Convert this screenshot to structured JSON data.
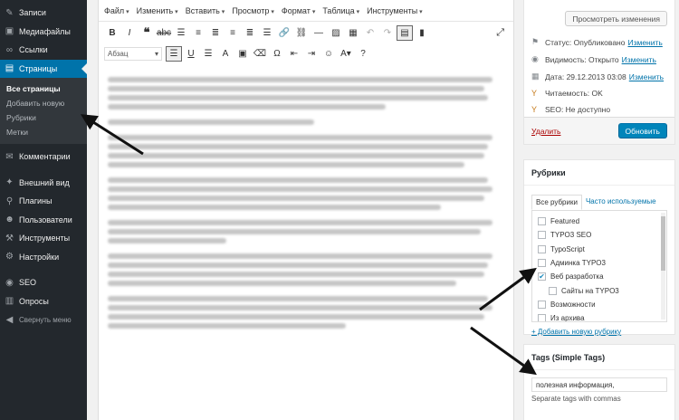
{
  "sidebar": {
    "items_top": [
      {
        "label": "Записи",
        "icon": "pin-icon",
        "glyph": "✎"
      },
      {
        "label": "Медиафайлы",
        "icon": "media-icon",
        "glyph": "▣"
      },
      {
        "label": "Ссылки",
        "icon": "link-icon",
        "glyph": "∞"
      }
    ],
    "active": {
      "label": "Страницы",
      "icon": "pages-icon",
      "glyph": "▤"
    },
    "sub_items": [
      "Все страницы",
      "Добавить новую",
      "Рубрики",
      "Метки"
    ],
    "items_mid": [
      {
        "label": "Комментарии",
        "icon": "comments-icon",
        "glyph": "✉"
      }
    ],
    "items_bottom": [
      {
        "label": "Внешний вид",
        "icon": "appearance-icon",
        "glyph": "✦"
      },
      {
        "label": "Плагины",
        "icon": "plugins-icon",
        "glyph": "⚲"
      },
      {
        "label": "Пользователи",
        "icon": "users-icon",
        "glyph": "☻"
      },
      {
        "label": "Инструменты",
        "icon": "tools-icon",
        "glyph": "⚒"
      },
      {
        "label": "Настройки",
        "icon": "settings-icon",
        "glyph": "⚙"
      }
    ],
    "items_plugins": [
      {
        "label": "SEO",
        "icon": "seo-icon",
        "glyph": "◉"
      },
      {
        "label": "Опросы",
        "icon": "polls-icon",
        "glyph": "▥"
      }
    ],
    "collapse": "Свернуть меню"
  },
  "editor": {
    "menu": [
      "Файл",
      "Изменить",
      "Вставить",
      "Просмотр",
      "Формат",
      "Таблица",
      "Инструменты"
    ],
    "format_select": "Абзац"
  },
  "publish": {
    "preview_button": "Просмотреть изменения",
    "status_label": "Статус:",
    "status_value": "Опубликовано",
    "status_link": "Изменить",
    "visibility_label": "Видимость:",
    "visibility_value": "Открыто",
    "visibility_link": "Изменить",
    "date_label": "Дата:",
    "date_value": "29.12.2013 03:08",
    "date_link": "Изменить",
    "readability": "Читаемость: OK",
    "seo": "SEO: Не доступно",
    "delete_link": "Удалить",
    "update_button": "Обновить"
  },
  "categories": {
    "title": "Рубрики",
    "tab_all": "Все рубрики",
    "tab_popular": "Часто используемые",
    "items": [
      {
        "label": "Featured",
        "checked": false,
        "child": false
      },
      {
        "label": "TYPO3 SEO",
        "checked": false,
        "child": false
      },
      {
        "label": "TypoScript",
        "checked": false,
        "child": false
      },
      {
        "label": "Админка TYPO3",
        "checked": false,
        "child": false
      },
      {
        "label": "Веб разработка",
        "checked": true,
        "child": false
      },
      {
        "label": "Сайты на TYPO3",
        "checked": false,
        "child": true
      },
      {
        "label": "Возможности",
        "checked": false,
        "child": false
      },
      {
        "label": "Из архива",
        "checked": false,
        "child": false
      }
    ],
    "add_link": "+ Добавить новую рубрику"
  },
  "tags": {
    "title": "Tags (Simple Tags)",
    "value": "полезная информация,",
    "hint": "Separate tags with commas"
  },
  "colors": {
    "sidebar_bg": "#23282d",
    "accent": "#0073aa",
    "primary_button": "#0085ba",
    "annotation_arrow": "#111111"
  }
}
